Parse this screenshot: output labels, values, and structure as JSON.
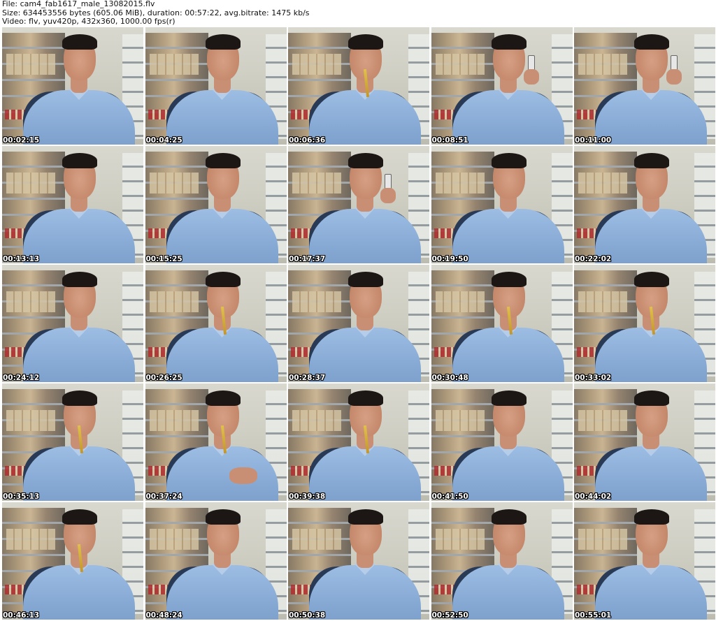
{
  "header": {
    "file_line": "File: cam4_fab1617_male_13082015.flv",
    "size_line": "Size: 634453556 bytes (605.06 MiB), duration: 00:57:22, avg.bitrate: 1475 kb/s",
    "video_line": "Video: flv, yuv420p, 432x360, 1000.00 fps(r)"
  },
  "thumbnails": [
    {
      "time": "00:02:15",
      "prop": "none"
    },
    {
      "time": "00:04:25",
      "prop": "none"
    },
    {
      "time": "00:06:36",
      "prop": "pencil"
    },
    {
      "time": "00:08:51",
      "prop": "phone"
    },
    {
      "time": "00:11:00",
      "prop": "phone"
    },
    {
      "time": "00:13:13",
      "prop": "none"
    },
    {
      "time": "00:15:25",
      "prop": "none"
    },
    {
      "time": "00:17:37",
      "prop": "phone"
    },
    {
      "time": "00:19:50",
      "prop": "none"
    },
    {
      "time": "00:22:02",
      "prop": "none"
    },
    {
      "time": "00:24:12",
      "prop": "none"
    },
    {
      "time": "00:26:25",
      "prop": "pencil"
    },
    {
      "time": "00:28:37",
      "prop": "none"
    },
    {
      "time": "00:30:48",
      "prop": "pencil"
    },
    {
      "time": "00:33:02",
      "prop": "pencil"
    },
    {
      "time": "00:35:13",
      "prop": "pencil"
    },
    {
      "time": "00:37:24",
      "prop": "pencil-hand"
    },
    {
      "time": "00:39:38",
      "prop": "pencil"
    },
    {
      "time": "00:41:50",
      "prop": "none"
    },
    {
      "time": "00:44:02",
      "prop": "none"
    },
    {
      "time": "00:46:13",
      "prop": "pencil"
    },
    {
      "time": "00:48:24",
      "prop": "none"
    },
    {
      "time": "00:50:38",
      "prop": "none"
    },
    {
      "time": "00:52:50",
      "prop": "none"
    },
    {
      "time": "00:55:01",
      "prop": "none"
    }
  ]
}
